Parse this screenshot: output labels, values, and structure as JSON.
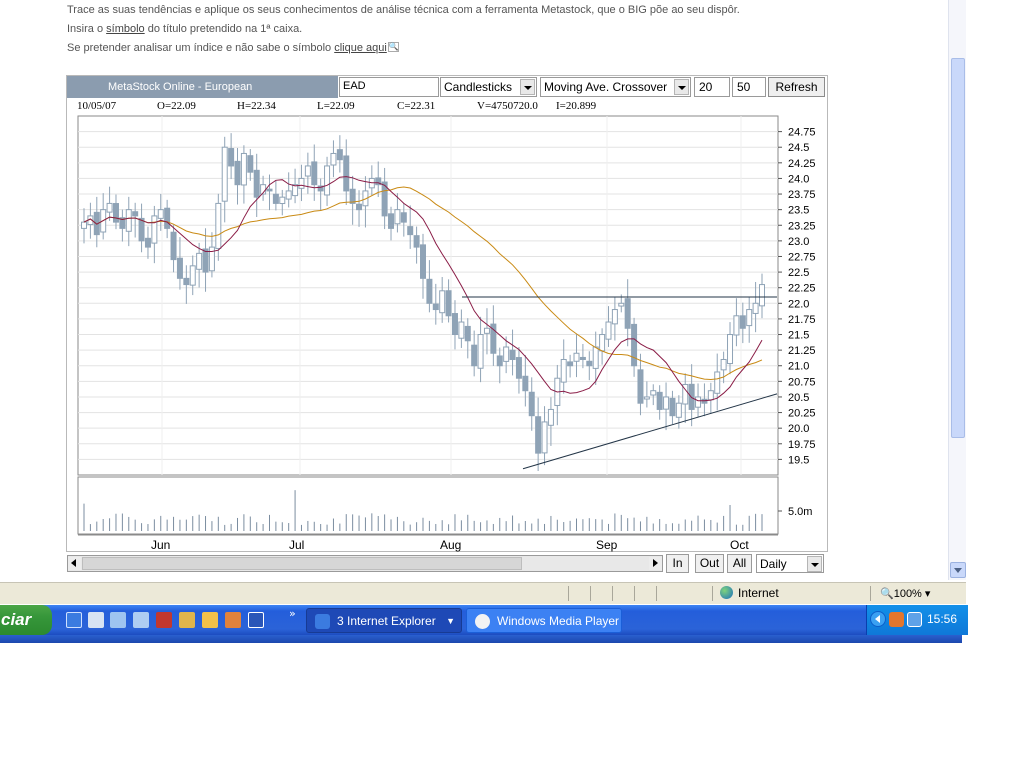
{
  "intro": {
    "line1": "Trace as suas tendências e aplique os seus conhecimentos de análise técnica com a ferramenta Metastock, que o BIG põe ao seu dispôr.",
    "line2_pre": "Insira o ",
    "line2_link": "símbolo",
    "line2_post": " do título pretendido na 1ª caixa.",
    "line3_pre": "Se pretender analisar um índice e não sabe o símbolo ",
    "line3_link": "clique aqui"
  },
  "metastock": {
    "title": "MetaStock Online - European",
    "symbol": "EAD",
    "chart_style": "Candlesticks",
    "indicator": "Moving Ave. Crossover",
    "period_short": "20",
    "period_long": "50",
    "refresh_label": "Refresh",
    "quote": {
      "date": "10/05/07",
      "open": "O=22.09",
      "high": "H=22.34",
      "low": "L=22.09",
      "close": "C=22.31",
      "volume": "V=4750720.0",
      "indicator": "I=20.899"
    },
    "buttons": {
      "zoom_in": "In",
      "zoom_out": "Out",
      "all": "All"
    },
    "interval": "Daily"
  },
  "chart_data": {
    "type": "candlestick",
    "y_ticks": [
      "24.75",
      "24.5",
      "24.25",
      "24.0",
      "23.75",
      "23.5",
      "23.25",
      "23.0",
      "22.75",
      "22.5",
      "22.25",
      "22.0",
      "21.75",
      "21.5",
      "21.25",
      "21.0",
      "20.75",
      "20.5",
      "20.25",
      "20.0",
      "19.75",
      "19.5"
    ],
    "ylim": [
      19.25,
      25.0
    ],
    "x_labels": [
      "Jun",
      "Jul",
      "Aug",
      "Sep",
      "Oct"
    ],
    "volume_label": "5.0m",
    "colors": {
      "candle": "#8fa3b6",
      "ma20": "#8a1c46",
      "ma50": "#c98a14",
      "trendline": "#233547",
      "grid": "#e3e3e3"
    },
    "horizontal_resistance": 22.1,
    "support_line": {
      "from": {
        "x": "Aug 14",
        "y": 19.35
      },
      "to": {
        "x": "Oct 12",
        "y": 20.55
      }
    },
    "series": [
      {
        "kind": "price",
        "closes": [
          23.3,
          23.4,
          23.1,
          23.5,
          23.6,
          23.3,
          23.2,
          23.5,
          23.4,
          23.0,
          22.9,
          23.4,
          23.5,
          23.2,
          22.7,
          22.4,
          22.3,
          22.6,
          22.8,
          22.5,
          22.9,
          23.6,
          24.5,
          24.2,
          23.9,
          24.4,
          24.1,
          23.7,
          23.9,
          23.8,
          23.6,
          23.7,
          23.8,
          23.9,
          24.0,
          24.2,
          23.9,
          23.8,
          24.2,
          24.4,
          24.3,
          23.8,
          23.6,
          23.5,
          23.8,
          24.0,
          23.9,
          23.4,
          23.2,
          23.5,
          23.3,
          23.1,
          22.9,
          22.4,
          22.0,
          21.9,
          22.2,
          21.8,
          21.5,
          21.7,
          21.4,
          21.0,
          21.5,
          21.6,
          21.2,
          21.0,
          21.3,
          21.1,
          20.8,
          20.6,
          20.2,
          19.6,
          20.1,
          20.3,
          20.8,
          21.1,
          21.0,
          21.2,
          21.1,
          21.0,
          21.3,
          21.5,
          21.7,
          21.9,
          22.0,
          21.6,
          21.0,
          20.4,
          20.5,
          20.6,
          20.3,
          20.5,
          20.2,
          20.4,
          20.7,
          20.3,
          20.5,
          20.4,
          20.6,
          20.9,
          21.1,
          21.5,
          21.8,
          21.6,
          21.9,
          22.0,
          22.3
        ]
      }
    ]
  }
}
